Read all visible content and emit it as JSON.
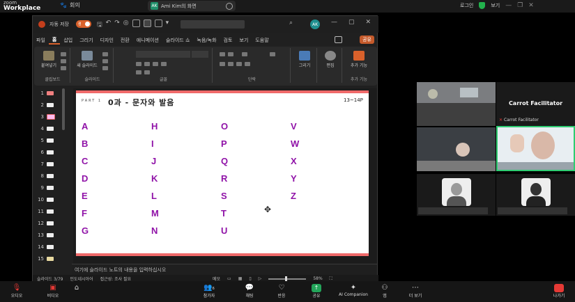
{
  "zoom": {
    "logo_small": "zoom",
    "logo_big": "Workplace",
    "meeting_label": "회의",
    "share_label": "Ami Kim의 화면",
    "share_avatar": "AK",
    "top_right": {
      "minimize": "로그인",
      "view": "보기"
    }
  },
  "ppt": {
    "autosave_label": "자동 저장",
    "toggle_state": "켬",
    "user_initials": "AK",
    "menu_tabs": [
      "파일",
      "홈",
      "삽입",
      "그리기",
      "디자인",
      "전환",
      "애니메이션",
      "슬라이드 쇼",
      "녹음/녹화",
      "검토",
      "보기",
      "도움말"
    ],
    "active_tab": "홈",
    "share_button": "공유",
    "ribbon_groups": {
      "clipboard": {
        "label": "클립보드",
        "paste": "붙여넣기"
      },
      "slides": {
        "label": "슬라이드",
        "new_slide": "새 슬라이드"
      },
      "font": {
        "label": "글꼴"
      },
      "paragraph": {
        "label": "단락"
      },
      "drawing": {
        "draw_label": "그리기"
      },
      "editing": {
        "label": "편집"
      },
      "addins": {
        "label": "추가 기능",
        "button": "추가 기능"
      }
    },
    "slide_numbers": [
      "1",
      "2",
      "3",
      "4",
      "5",
      "6",
      "7",
      "8",
      "9",
      "10",
      "11",
      "12",
      "13",
      "14",
      "15"
    ],
    "selected_slide": "3",
    "slide": {
      "part_label": "PART 1",
      "title": "0과 - 문자와 발음",
      "page_range": "13~14P",
      "columns": [
        [
          "A",
          "B",
          "C",
          "D",
          "E",
          "F",
          "G"
        ],
        [
          "H",
          "I",
          "J",
          "K",
          "L",
          "M",
          "N"
        ],
        [
          "O",
          "P",
          "Q",
          "R",
          "S",
          "T",
          "U"
        ],
        [
          "V",
          "W",
          "X",
          "Y",
          "Z"
        ]
      ]
    },
    "notes_placeholder": "여기에 슬라이드 노트의 내용을 입력하십시오",
    "status": {
      "slide_count": "슬라이드 3/79",
      "language": "인도네시아어",
      "accessibility": "접근성: 조사 필요",
      "notes_btn": "메모",
      "zoom_level": "58%"
    }
  },
  "participants": {
    "facilitator_name": "Carrot Facilitator",
    "facilitator_sub": "Carrot Facilitator"
  },
  "toolbar": {
    "audio": "오디오",
    "video": "비디오",
    "participants": "참가자",
    "participants_count": "6",
    "chat": "채팅",
    "reactions": "반응",
    "share": "공유",
    "ai": "AI Companion",
    "apps": "앱",
    "more": "더 보기",
    "leave": "나가기"
  }
}
